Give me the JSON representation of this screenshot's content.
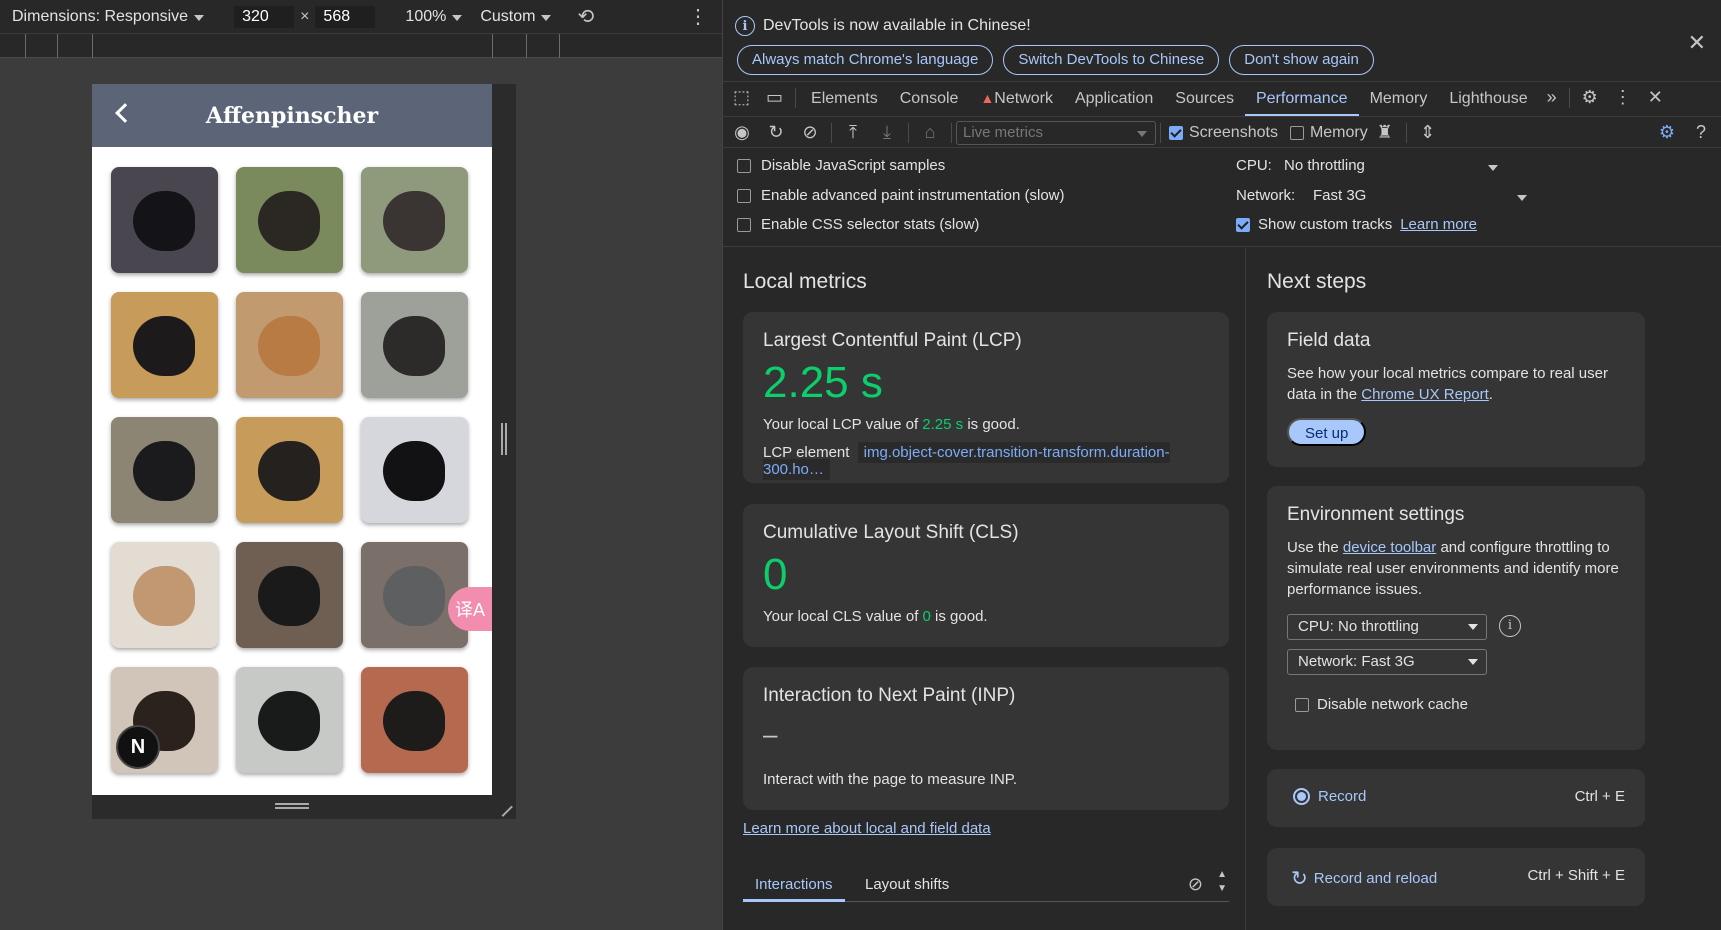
{
  "device_toolbar": {
    "dimensions_label": "Dimensions: Responsive",
    "width": "320",
    "times": "×",
    "height": "568",
    "zoom": "100%",
    "throttle": "Custom"
  },
  "page": {
    "title": "Affenpinscher",
    "translate_glyph": "译A",
    "n_badge": "N"
  },
  "thumbnails": [
    {
      "bg": "#4a4650",
      "dog": "#141317"
    },
    {
      "bg": "#7a8a5c",
      "dog": "#2b2723"
    },
    {
      "bg": "#8f9a7c",
      "dog": "#3a3533"
    },
    {
      "bg": "#c79b5a",
      "dog": "#1c1a1b"
    },
    {
      "bg": "#c29a70",
      "dog": "#b77b43"
    },
    {
      "bg": "#9ea19a",
      "dog": "#2d2b2a"
    },
    {
      "bg": "#8d8574",
      "dog": "#1b1a1d"
    },
    {
      "bg": "#c79b5a",
      "dog": "#25211e"
    },
    {
      "bg": "#d5d7dc",
      "dog": "#121215"
    },
    {
      "bg": "#e2dcd2",
      "dog": "#c29873"
    },
    {
      "bg": "#6f5f52",
      "dog": "#1a1a1a"
    },
    {
      "bg": "#7b6f6a",
      "dog": "#5d5f60"
    },
    {
      "bg": "#d1c4b8",
      "dog": "#2c221d"
    },
    {
      "bg": "#c7c9c6",
      "dog": "#181b1a"
    },
    {
      "bg": "#b56a4f",
      "dog": "#1e1b1b"
    }
  ],
  "infobar": {
    "message": "DevTools is now available in Chinese!",
    "btn_match": "Always match Chrome's language",
    "btn_switch": "Switch DevTools to Chinese",
    "btn_dont": "Don't show again"
  },
  "tabs": [
    "Elements",
    "Console",
    "Network",
    "Application",
    "Sources",
    "Performance",
    "Memory",
    "Lighthouse"
  ],
  "toolbar": {
    "live_metrics": "Live metrics",
    "screenshots": "Screenshots",
    "memory": "Memory"
  },
  "settings": {
    "disable_js": "Disable JavaScript samples",
    "adv_paint": "Enable advanced paint instrumentation (slow)",
    "css_stats": "Enable CSS selector stats (slow)",
    "cpu_label": "CPU:",
    "cpu_value": "No throttling",
    "network_label": "Network:",
    "network_value": "Fast 3G",
    "custom_tracks": "Show custom tracks",
    "learn_more": "Learn more"
  },
  "local_metrics": {
    "heading": "Local metrics",
    "lcp": {
      "title": "Largest Contentful Paint (LCP)",
      "value": "2.25 s",
      "sentence_pre": "Your local LCP value of ",
      "sentence_val": "2.25 s",
      "sentence_post": " is good.",
      "element_label": "LCP element",
      "element_value": "img.object-cover.transition-transform.duration-300.ho…"
    },
    "cls": {
      "title": "Cumulative Layout Shift (CLS)",
      "value": "0",
      "sentence_pre": "Your local CLS value of ",
      "sentence_val": "0",
      "sentence_post": " is good."
    },
    "inp": {
      "title": "Interaction to Next Paint (INP)",
      "value": "–",
      "sentence": "Interact with the page to measure INP."
    },
    "learn_link": "Learn more about local and field data",
    "tab_interactions": "Interactions",
    "tab_layout_shifts": "Layout shifts"
  },
  "next_steps": {
    "heading": "Next steps",
    "field": {
      "title": "Field data",
      "desc_pre": "See how your local metrics compare to real user data in the ",
      "desc_link": "Chrome UX Report",
      "desc_post": ".",
      "button": "Set up"
    },
    "env": {
      "title": "Environment settings",
      "desc_pre": "Use the ",
      "desc_link": "device toolbar",
      "desc_post": " and configure throttling to simulate real user environments and identify more performance issues.",
      "cpu_select": "CPU: No throttling",
      "network_select": "Network: Fast 3G",
      "disable_cache": "Disable network cache"
    },
    "record": {
      "label": "Record",
      "shortcut": "Ctrl + E"
    },
    "record_reload": {
      "label": "Record and reload",
      "shortcut": "Ctrl + Shift + E"
    }
  },
  "colors": {
    "accent": "#a8c7fa",
    "good": "#0cce6b",
    "appbar": "#5b6577"
  }
}
